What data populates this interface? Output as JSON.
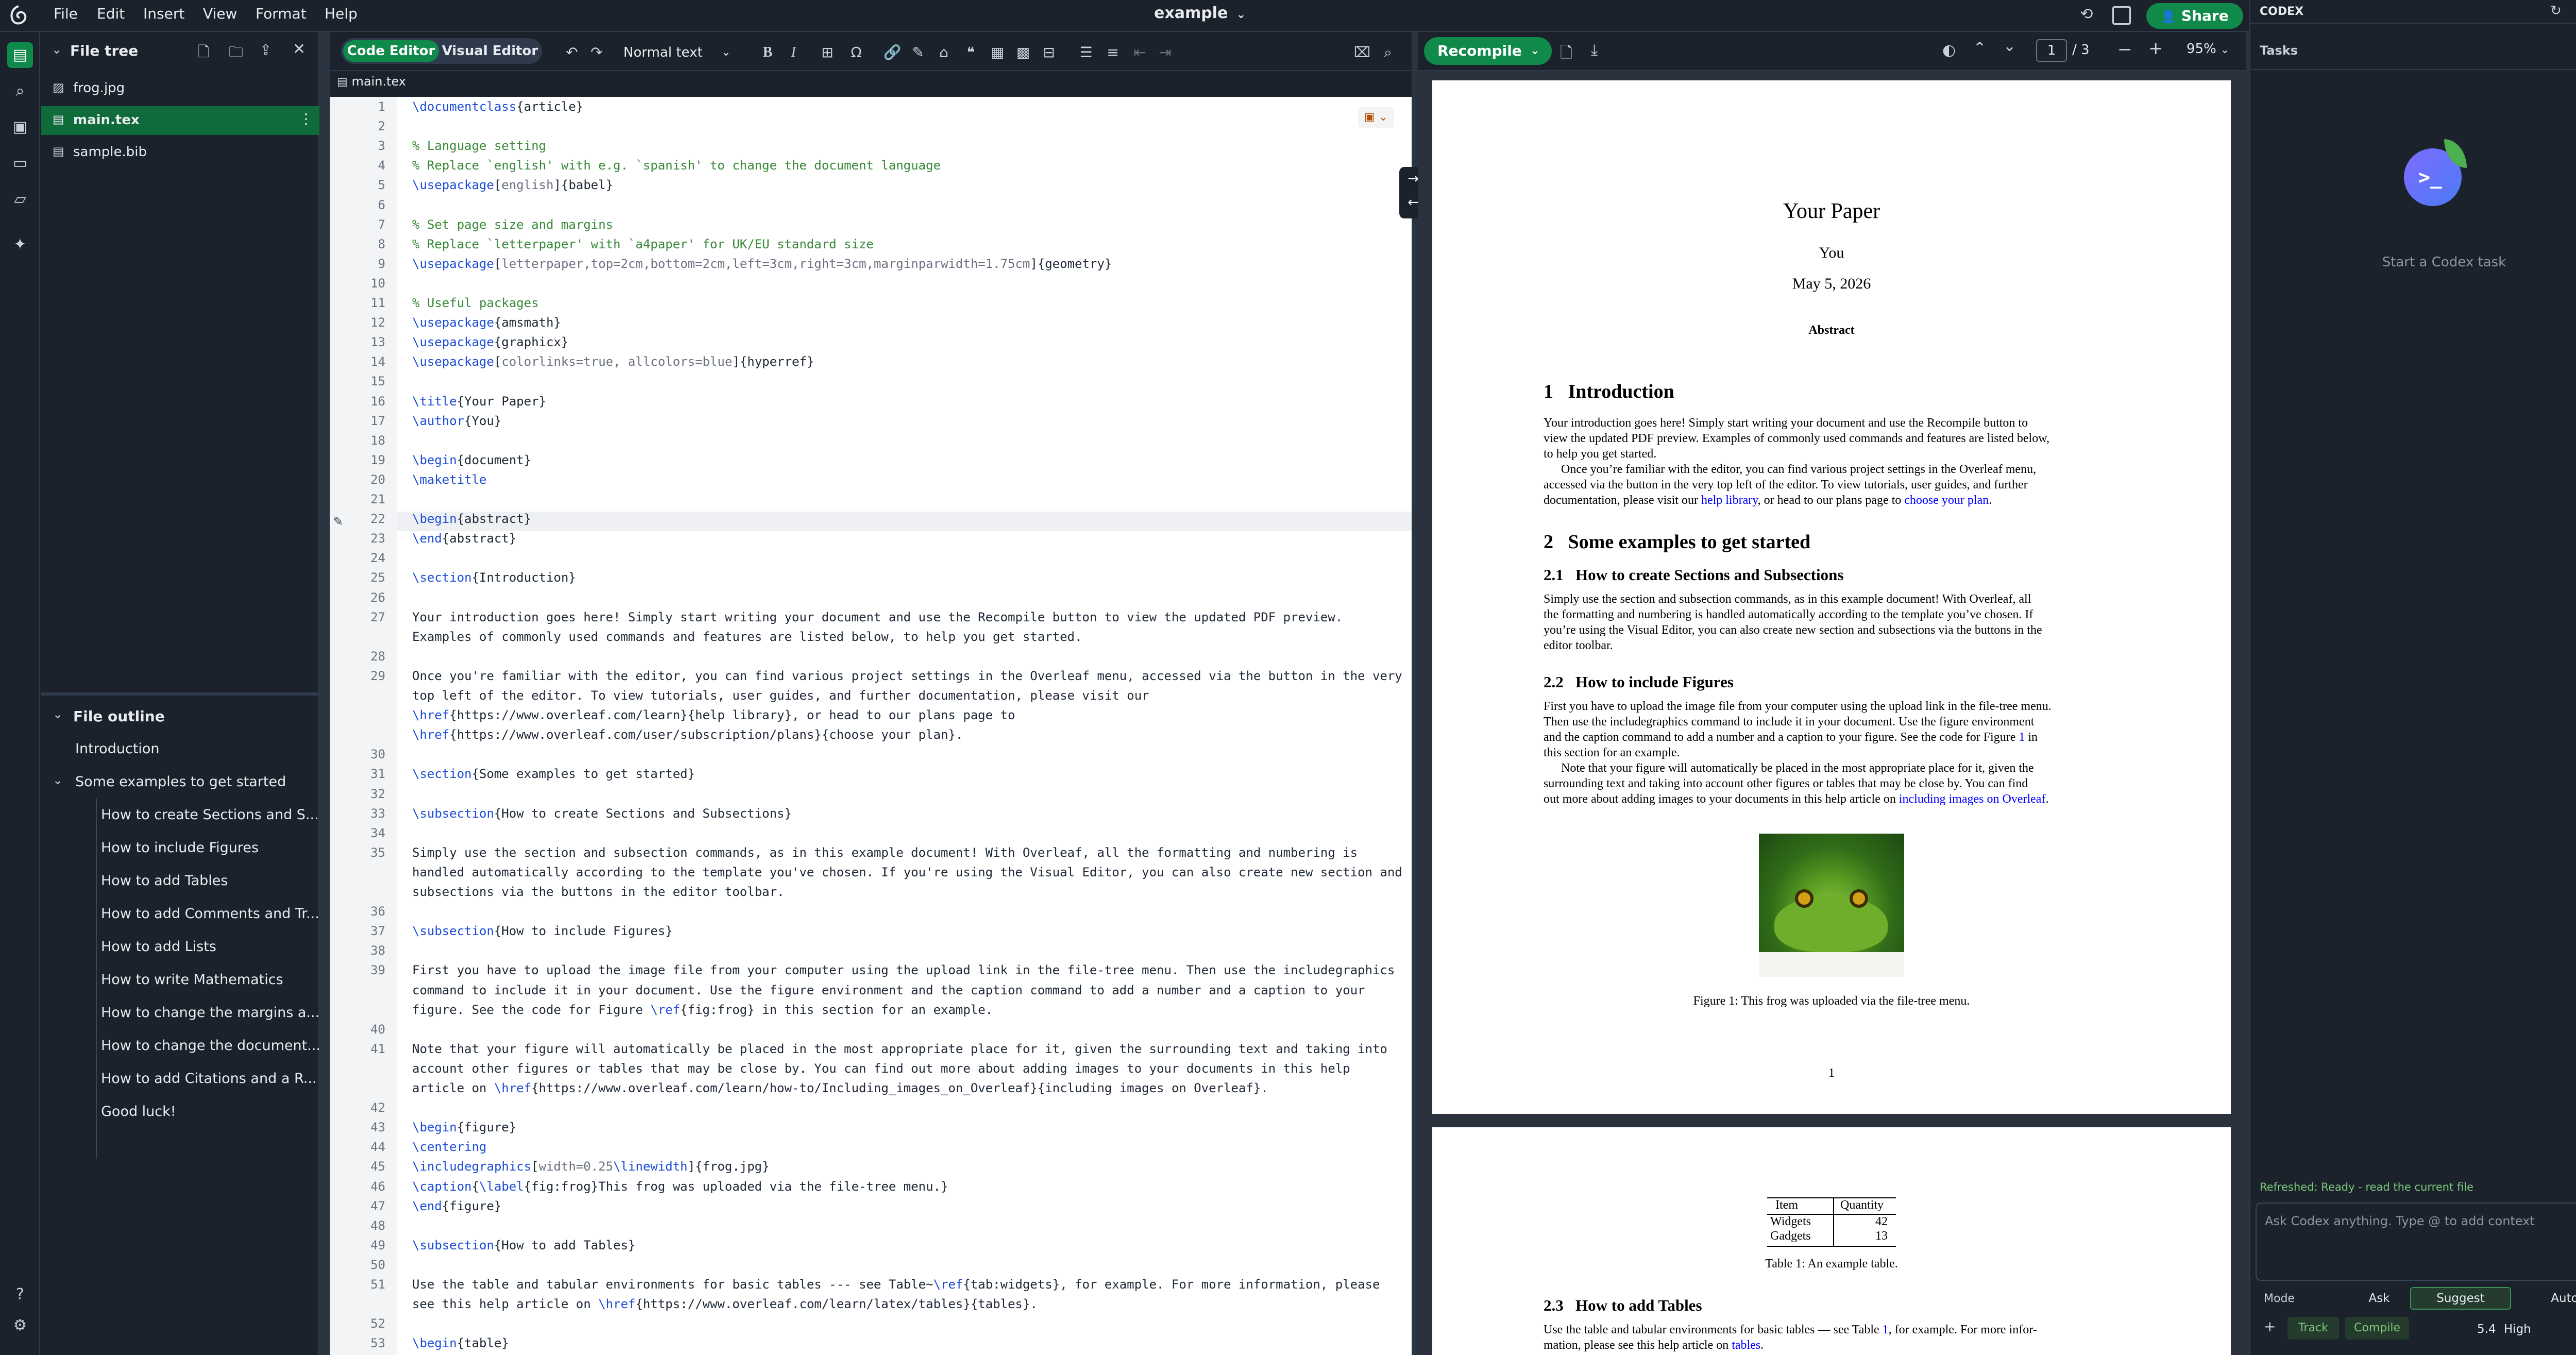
{
  "project_title": "example",
  "menu": [
    "File",
    "Edit",
    "Insert",
    "View",
    "Format",
    "Help"
  ],
  "share_label": "Share",
  "file_tree": {
    "title": "File tree",
    "files": [
      "frog.jpg",
      "main.tex",
      "sample.bib"
    ]
  },
  "outline": {
    "title": "File outline",
    "items": [
      "Introduction",
      "Some examples to get started",
      "How to create Sections and S...",
      "How to include Figures",
      "How to add Tables",
      "How to add Comments and Tr...",
      "How to add Lists",
      "How to write Mathematics",
      "How to change the margins a...",
      "How to change the document...",
      "How to add Citations and a R...",
      "Good luck!"
    ]
  },
  "editor": {
    "code_editor_label": "Code Editor",
    "visual_editor_label": "Visual Editor",
    "style_select": "Normal text",
    "tab": "main.tex",
    "lines": [
      {
        "n": "1",
        "t": "\\documentclass{article}"
      },
      {
        "n": "2",
        "t": ""
      },
      {
        "n": "3",
        "t": "% Language setting"
      },
      {
        "n": "4",
        "t": "% Replace `english' with e.g. `spanish' to change the document language"
      },
      {
        "n": "5",
        "t": "\\usepackage[english]{babel}"
      },
      {
        "n": "6",
        "t": ""
      },
      {
        "n": "7",
        "t": "% Set page size and margins"
      },
      {
        "n": "8",
        "t": "% Replace `letterpaper' with `a4paper' for UK/EU standard size"
      },
      {
        "n": "9",
        "t": "\\usepackage[letterpaper,top=2cm,bottom=2cm,left=3cm,right=3cm,marginparwidth=1.75cm]{geometry}"
      },
      {
        "n": "10",
        "t": ""
      },
      {
        "n": "11",
        "t": "% Useful packages"
      },
      {
        "n": "12",
        "t": "\\usepackage{amsmath}"
      },
      {
        "n": "13",
        "t": "\\usepackage{graphicx}"
      },
      {
        "n": "14",
        "t": "\\usepackage[colorlinks=true, allcolors=blue]{hyperref}"
      },
      {
        "n": "15",
        "t": ""
      },
      {
        "n": "16",
        "t": "\\title{Your Paper}"
      },
      {
        "n": "17",
        "t": "\\author{You}"
      },
      {
        "n": "18",
        "t": ""
      },
      {
        "n": "19",
        "t": "\\begin{document}"
      },
      {
        "n": "20",
        "t": "\\maketitle"
      },
      {
        "n": "21",
        "t": ""
      },
      {
        "n": "22",
        "t": "\\begin{abstract}"
      },
      {
        "n": "23",
        "t": "\\end{abstract}"
      },
      {
        "n": "24",
        "t": ""
      },
      {
        "n": "25",
        "t": "\\section{Introduction}"
      },
      {
        "n": "26",
        "t": ""
      },
      {
        "n": "27",
        "t": "Your introduction goes here! Simply start writing your document and use the Recompile button to view the updated PDF preview."
      },
      {
        "n": "",
        "t": "Examples of commonly used commands and features are listed below, to help you get started."
      },
      {
        "n": "28",
        "t": ""
      },
      {
        "n": "29",
        "t": "Once you're familiar with the editor, you can find various project settings in the Overleaf menu, accessed via the button in the very"
      },
      {
        "n": "",
        "t": "top left of the editor. To view tutorials, user guides, and further documentation, please visit our"
      },
      {
        "n": "",
        "t": "\\href{https://www.overleaf.com/learn}{help library}, or head to our plans page to"
      },
      {
        "n": "",
        "t": "\\href{https://www.overleaf.com/user/subscription/plans}{choose your plan}."
      },
      {
        "n": "30",
        "t": ""
      },
      {
        "n": "31",
        "t": "\\section{Some examples to get started}"
      },
      {
        "n": "32",
        "t": ""
      },
      {
        "n": "33",
        "t": "\\subsection{How to create Sections and Subsections}"
      },
      {
        "n": "34",
        "t": ""
      },
      {
        "n": "35",
        "t": "Simply use the section and subsection commands, as in this example document! With Overleaf, all the formatting and numbering is"
      },
      {
        "n": "",
        "t": "handled automatically according to the template you've chosen. If you're using the Visual Editor, you can also create new section and"
      },
      {
        "n": "",
        "t": "subsections via the buttons in the editor toolbar."
      },
      {
        "n": "36",
        "t": ""
      },
      {
        "n": "37",
        "t": "\\subsection{How to include Figures}"
      },
      {
        "n": "38",
        "t": ""
      },
      {
        "n": "39",
        "t": "First you have to upload the image file from your computer using the upload link in the file-tree menu. Then use the includegraphics"
      },
      {
        "n": "",
        "t": "command to include it in your document. Use the figure environment and the caption command to add a number and a caption to your"
      },
      {
        "n": "",
        "t": "figure. See the code for Figure \\ref{fig:frog} in this section for an example."
      },
      {
        "n": "40",
        "t": ""
      },
      {
        "n": "41",
        "t": "Note that your figure will automatically be placed in the most appropriate place for it, given the surrounding text and taking into"
      },
      {
        "n": "",
        "t": "account other figures or tables that may be close by. You can find out more about adding images to your documents in this help"
      },
      {
        "n": "",
        "t": "article on \\href{https://www.overleaf.com/learn/how-to/Including_images_on_Overleaf}{including images on Overleaf}."
      },
      {
        "n": "42",
        "t": ""
      },
      {
        "n": "43",
        "t": "\\begin{figure}"
      },
      {
        "n": "44",
        "t": "\\centering"
      },
      {
        "n": "45",
        "t": "\\includegraphics[width=0.25\\linewidth]{frog.jpg}"
      },
      {
        "n": "46",
        "t": "\\caption{\\label{fig:frog}This frog was uploaded via the file-tree menu.}"
      },
      {
        "n": "47",
        "t": "\\end{figure}"
      },
      {
        "n": "48",
        "t": ""
      },
      {
        "n": "49",
        "t": "\\subsection{How to add Tables}"
      },
      {
        "n": "50",
        "t": ""
      },
      {
        "n": "51",
        "t": "Use the table and tabular environments for basic tables --- see Table~\\ref{tab:widgets}, for example. For more information, please"
      },
      {
        "n": "",
        "t": "see this help article on \\href{https://www.overleaf.com/learn/latex/tables}{tables}."
      },
      {
        "n": "52",
        "t": ""
      },
      {
        "n": "53",
        "t": "\\begin{table}"
      }
    ]
  },
  "pdf": {
    "recompile_label": "Recompile",
    "page_current": "1",
    "page_total": "/ 3",
    "zoom": "95%",
    "title": "Your Paper",
    "author": "You",
    "date": "May 5, 2026",
    "abstract_heading": "Abstract",
    "sec1": "1   Introduction",
    "intro_p1": "Your introduction goes here!  Simply start writing your document and use the Recompile button to",
    "intro_p1b": "view the updated PDF preview.  Examples of commonly used commands and features are listed below,",
    "intro_p1c": "to help you get started.",
    "intro_p2": "Once you’re familiar with the editor, you can find various project settings in the Overleaf menu,",
    "intro_p2b": "accessed via the button in the very top left of the editor.  To view tutorials, user guides, and further",
    "intro_p2c_a": "documentation, please visit our",
    "intro_p2c_link1": "help library",
    "intro_p2c_b": ", or head to our plans page to",
    "intro_p2c_link2": "choose your plan",
    "intro_p2c_end": ".",
    "sec2": "2   Some examples to get started",
    "sec21": "2.1   How to create Sections and Subsections",
    "sec21_p1": "Simply use the section and subsection commands, as in this example document!  With Overleaf, all",
    "sec21_p2": "the formatting and numbering is handled automatically according to the template you’ve chosen.  If",
    "sec21_p3": "you’re using the Visual Editor, you can also create new section and subsections via the buttons in the",
    "sec21_p4": "editor toolbar.",
    "sec22": "2.2   How to include Figures",
    "sec22_p1": "First you have to upload the image file from your computer using the upload link in the file-tree menu.",
    "sec22_p2": "Then use the includegraphics command to include it in your document.  Use the figure environment",
    "sec22_p3a": "and the caption command to add a number and a caption to your figure.  See the code for Figure",
    "sec22_p3link": "1",
    "sec22_p3b": " in",
    "sec22_p4": "this section for an example.",
    "sec22_p5": "Note that your figure will automatically be placed in the most appropriate place for it, given the",
    "sec22_p6": "surrounding text and taking into account other figures or tables that may be close by.  You can find",
    "sec22_p7a": "out more about adding images to your documents in this help article on",
    "sec22_p7link": "including images on Overleaf",
    "sec22_p7end": ".",
    "fig_caption": "Figure 1: This frog was uploaded via the file-tree menu.",
    "page_number": "1",
    "table_head_item": "Item",
    "table_head_qty": "Quantity",
    "table_rows": [
      {
        "item": "Widgets",
        "qty": "42"
      },
      {
        "item": "Gadgets",
        "qty": "13"
      }
    ],
    "table_caption": "Table 1: An example table.",
    "sec23": "2.3   How to add Tables",
    "sec23_p1a": "Use the table and tabular environments for basic tables — see Table",
    "sec23_p1link": "1",
    "sec23_p1b": ", for example.  For more infor-",
    "sec23_p2a": "mation, please see this help article on",
    "sec23_p2link": "tables",
    "sec23_p2end": "."
  },
  "codex": {
    "title": "CODEX",
    "tasks_label": "Tasks",
    "empty_text": "Start a Codex task",
    "status": "Refreshed: Ready - read the current file",
    "input_placeholder": "Ask Codex anything. Type @ to add context",
    "mode_label": "Mode",
    "modes": [
      "Ask",
      "Suggest",
      "Auto"
    ],
    "track_label": "Track",
    "compile_label": "Compile",
    "model": "5.4",
    "effort": "High"
  },
  "colors": {
    "accent_green": "#0f8a4a",
    "link_blue": "#0000ff",
    "dark_bg": "#1b222c"
  }
}
